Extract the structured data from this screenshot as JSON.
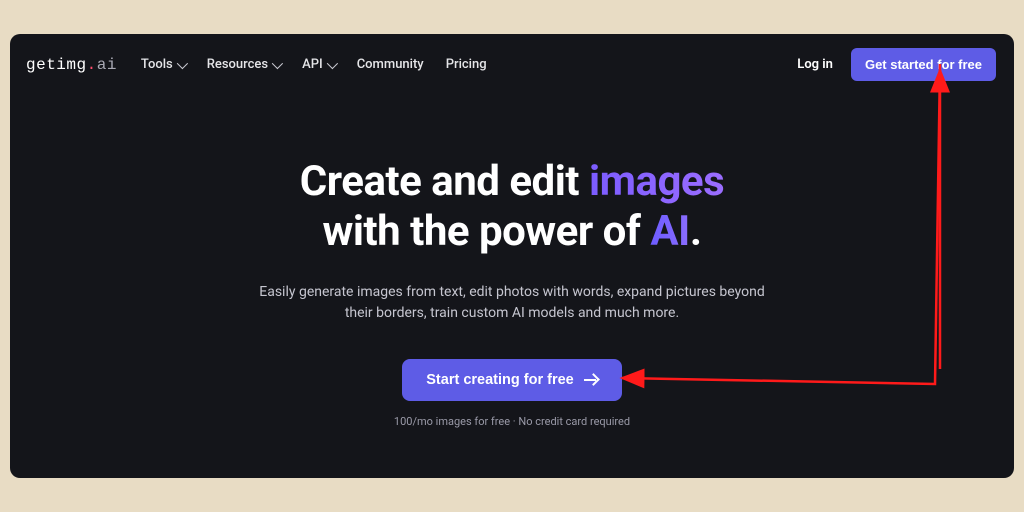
{
  "logo": {
    "part1": "getimg",
    "dot": ".",
    "part2": "ai"
  },
  "nav": {
    "items": [
      {
        "label": "Tools",
        "dropdown": true
      },
      {
        "label": "Resources",
        "dropdown": true
      },
      {
        "label": "API",
        "dropdown": true
      },
      {
        "label": "Community",
        "dropdown": false
      },
      {
        "label": "Pricing",
        "dropdown": false
      }
    ],
    "login": "Log in",
    "cta": "Get started for free"
  },
  "hero": {
    "line1_pre": "Create and edit ",
    "line1_highlight": "images",
    "line2_pre": "with the power of ",
    "line2_highlight": "AI",
    "line2_post": ".",
    "subtitle": "Easily generate images from text, edit photos with words, expand pictures beyond their borders, train custom AI models and much more.",
    "button": "Start creating for free",
    "microcopy": "100/mo images for free · No credit card required"
  },
  "colors": {
    "accent": "#5e5ce6",
    "bg": "#14151a",
    "annotation": "#ff1a1a"
  }
}
